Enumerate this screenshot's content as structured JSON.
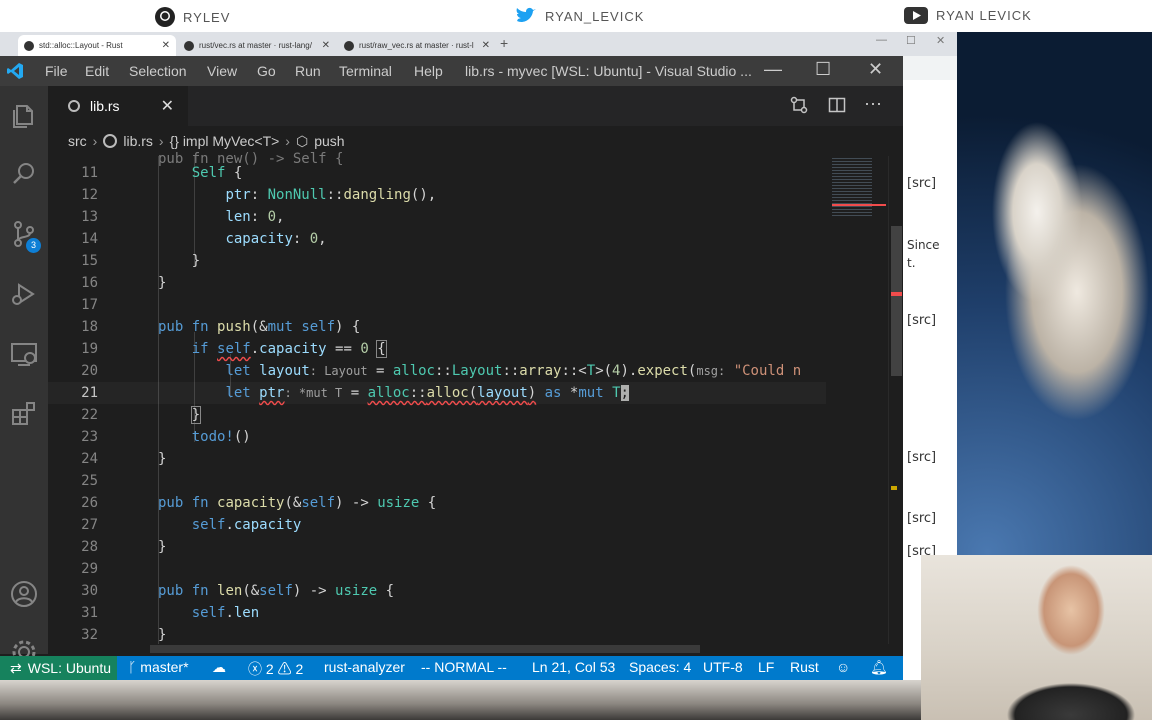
{
  "banner": {
    "github": "RYLEV",
    "twitter": "RYAN_LEVICK",
    "youtube": "RYAN LEVICK"
  },
  "browser": {
    "tabs": [
      {
        "label": "std::alloc::Layout - Rust"
      },
      {
        "label": "rust/vec.rs at master · rust-lang/"
      },
      {
        "label": "rust/raw_vec.rs at master · rust-l"
      }
    ],
    "side_labels": [
      "[src]",
      "Since",
      "t.",
      "[src]",
      "[src]",
      "[src]",
      "[src]"
    ]
  },
  "window": {
    "menu": [
      "File",
      "Edit",
      "Selection",
      "View",
      "Go",
      "Run",
      "Terminal",
      "Help"
    ],
    "title": "lib.rs - myvec [WSL: Ubuntu] - Visual Studio ..."
  },
  "activity": {
    "scm_badge": "3"
  },
  "tab": {
    "name": "lib.rs",
    "close": "✕"
  },
  "breadcrumb": {
    "parts": [
      "src",
      "lib.rs",
      "{} impl MyVec<T>",
      "push"
    ]
  },
  "editor": {
    "line_numbers": [
      "11",
      "12",
      "13",
      "14",
      "15",
      "16",
      "17",
      "18",
      "19",
      "20",
      "21",
      "22",
      "23",
      "24",
      "25",
      "26",
      "27",
      "28",
      "29",
      "30",
      "31",
      "32"
    ],
    "current_line": "21",
    "hints": {
      "layout_type": ": Layout",
      "msg": "msg:",
      "ptr_type": ": *mut T"
    },
    "strings": {
      "could": "\"Could n"
    }
  },
  "statusbar": {
    "remote": "WSL: Ubuntu",
    "branch": "master*",
    "errors": "2",
    "warnings": "2",
    "analyzer": "rust-analyzer",
    "mode": "-- NORMAL --",
    "position": "Ln 21, Col 53",
    "spaces": "Spaces: 4",
    "encoding": "UTF-8",
    "eol": "LF",
    "language": "Rust"
  }
}
